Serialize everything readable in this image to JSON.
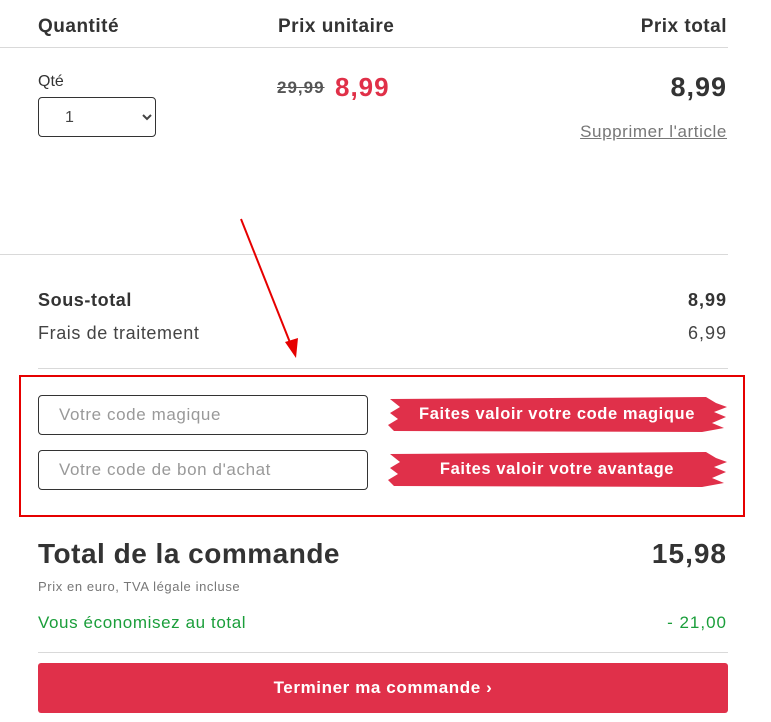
{
  "cart": {
    "headers": {
      "quantity": "Quantité",
      "unit_price": "Prix unitaire",
      "total_price": "Prix total"
    },
    "item": {
      "qty_label": "Qté",
      "qty_value": "1",
      "old_price": "29,99",
      "new_price": "8,99",
      "line_total": "8,99",
      "remove_label": "Supprimer l'article"
    },
    "subtotal_label": "Sous-total",
    "subtotal_value": "8,99",
    "fees_label": "Frais de traitement",
    "fees_value": "6,99",
    "promo": {
      "magic_placeholder": "Votre code magique",
      "magic_button": "Faites valoir votre code magique",
      "voucher_placeholder": "Votre code de bon d'achat",
      "voucher_button": "Faites valoir votre avantage"
    },
    "order_total_label": "Total de la commande",
    "order_total_value": "15,98",
    "tax_note": "Prix en euro, TVA légale incluse",
    "savings_label": "Vous économisez au total",
    "savings_value": "- 21,00",
    "checkout_label": "Terminer ma commande ›"
  },
  "colors": {
    "accent": "#e0304a",
    "savings": "#1a9e3a",
    "annotation": "#e60000"
  }
}
